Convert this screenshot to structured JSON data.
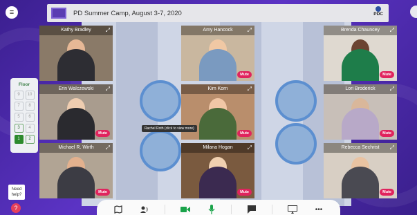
{
  "event": {
    "title": "PD Summer Camp, August 3-7, 2020",
    "brand": "PDC"
  },
  "floor_panel": {
    "label": "Floor",
    "floors": [
      {
        "id": "9",
        "state": "inactive"
      },
      {
        "id": "10",
        "state": "inactive"
      },
      {
        "id": "7",
        "state": "inactive"
      },
      {
        "id": "8",
        "state": "inactive"
      },
      {
        "id": "5",
        "state": "inactive"
      },
      {
        "id": "6",
        "state": "inactive"
      },
      {
        "id": "3",
        "state": "active"
      },
      {
        "id": "4",
        "state": "inactive"
      },
      {
        "id": "1",
        "state": "current"
      },
      {
        "id": "2",
        "state": "active"
      }
    ]
  },
  "help": {
    "label": "Need help?",
    "button_glyph": "?"
  },
  "mute_label": "Mute",
  "tooltip": "Rachel Roth (click to view more)",
  "participants": [
    {
      "name": "Kathy Bradley",
      "muted_button": true
    },
    {
      "name": "Amy Hancock",
      "muted_button": true
    },
    {
      "name": "Brenda Chauncey",
      "muted_button": true
    },
    {
      "name": "Erin Walczewski",
      "muted_button": true
    },
    {
      "name": "Kim Korn",
      "muted_button": true
    },
    {
      "name": "Lori Broderick",
      "muted_button": true
    },
    {
      "name": "Michael R. Wirth",
      "muted_button": true
    },
    {
      "name": "Milana Hogan",
      "muted_button": true
    },
    {
      "name": "Rebecca Sechrist",
      "muted_button": true
    }
  ],
  "toolbar": {
    "items": [
      "map-icon",
      "share-audio-icon",
      "camera-icon",
      "microphone-icon",
      "chat-icon",
      "screen-share-icon",
      "more-icon"
    ]
  },
  "colors": {
    "accent": "#e0245e",
    "background": "#4a2a9a",
    "camera": "#1aa34a",
    "floor_current": "#2c8a2c"
  }
}
